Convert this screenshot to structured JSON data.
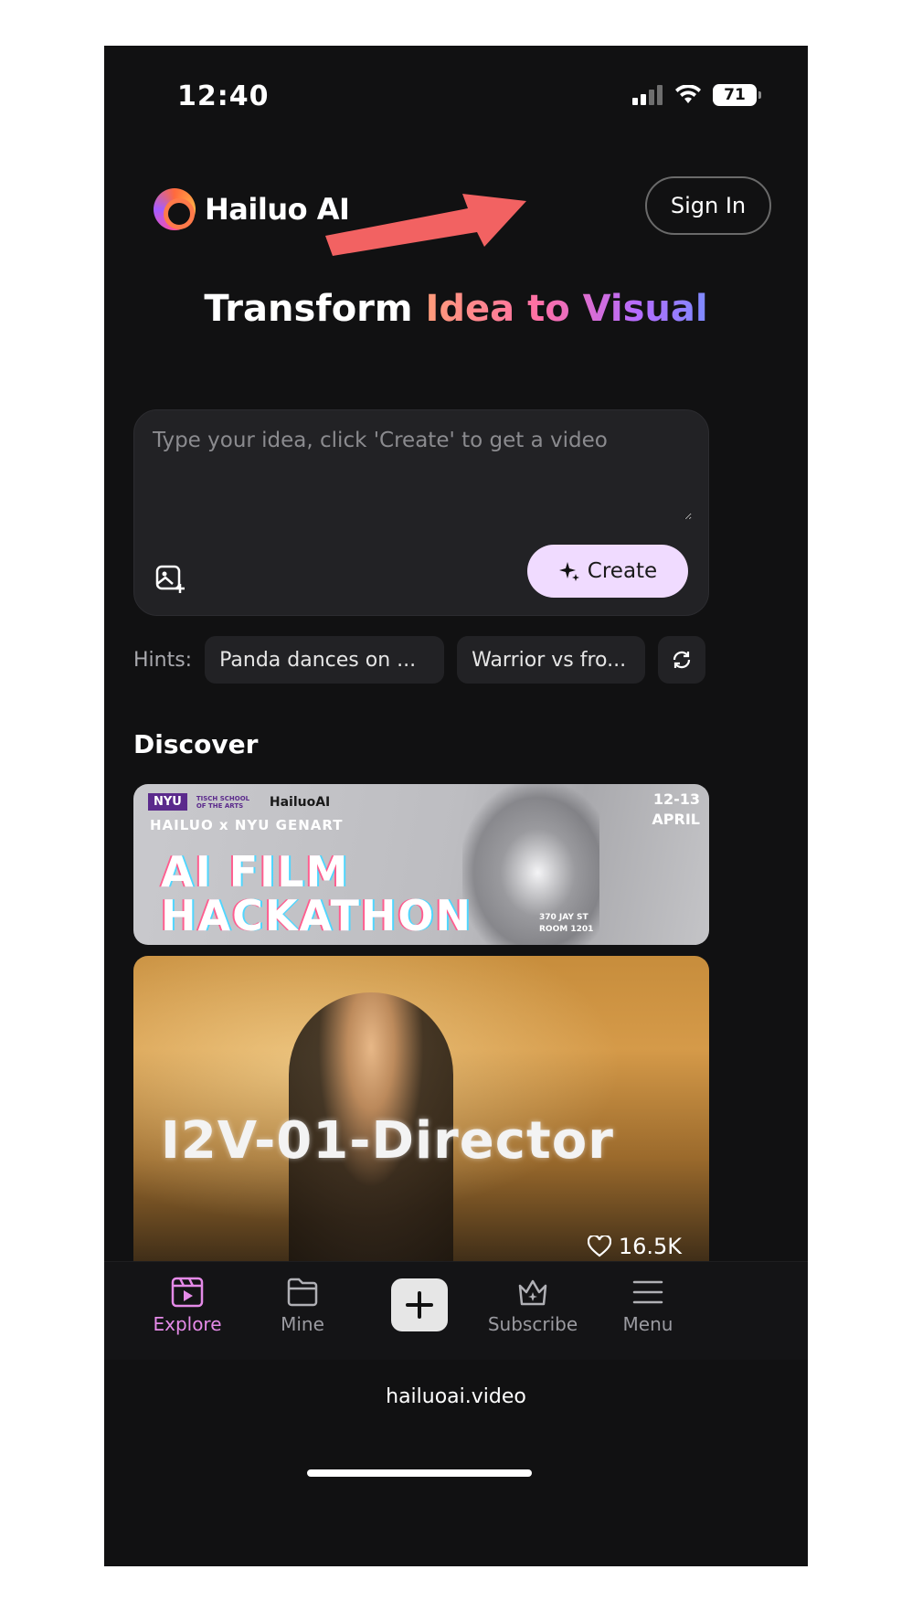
{
  "status": {
    "time": "12:40",
    "battery": "71"
  },
  "header": {
    "brand": "Hailuo AI",
    "sign_in_label": "Sign In"
  },
  "hero": {
    "headline_plain": "Transform",
    "headline_gradient": "Idea to Visual"
  },
  "prompt": {
    "placeholder": "Type your idea, click 'Create' to get a video",
    "create_label": "Create"
  },
  "hints": {
    "label": "Hints:",
    "items": [
      "Panda dances on ...",
      "Warrior vs fro..."
    ]
  },
  "discover": {
    "title": "Discover",
    "banner": {
      "org": "NYU",
      "org_sub": "TISCH SCHOOL OF THE ARTS",
      "partner": "HailuoAI",
      "subtitle": "HAILUO x NYU GENART",
      "title_line1": "AI FILM",
      "title_line2": "HACKATHON",
      "date_line1": "12-13",
      "date_line2": "APRIL",
      "address_line1": "370 JAY ST",
      "address_line2": "ROOM 1201"
    },
    "video": {
      "overlay_text": "I2V-01-Director",
      "likes": "16.5K"
    }
  },
  "tabs": {
    "explore": "Explore",
    "mine": "Mine",
    "subscribe": "Subscribe",
    "menu": "Menu"
  },
  "browser": {
    "url": "hailuoai.video"
  },
  "colors": {
    "accent": "#e58ae8",
    "create_bg": "#f0dbff",
    "annotation_arrow": "#f26262"
  }
}
